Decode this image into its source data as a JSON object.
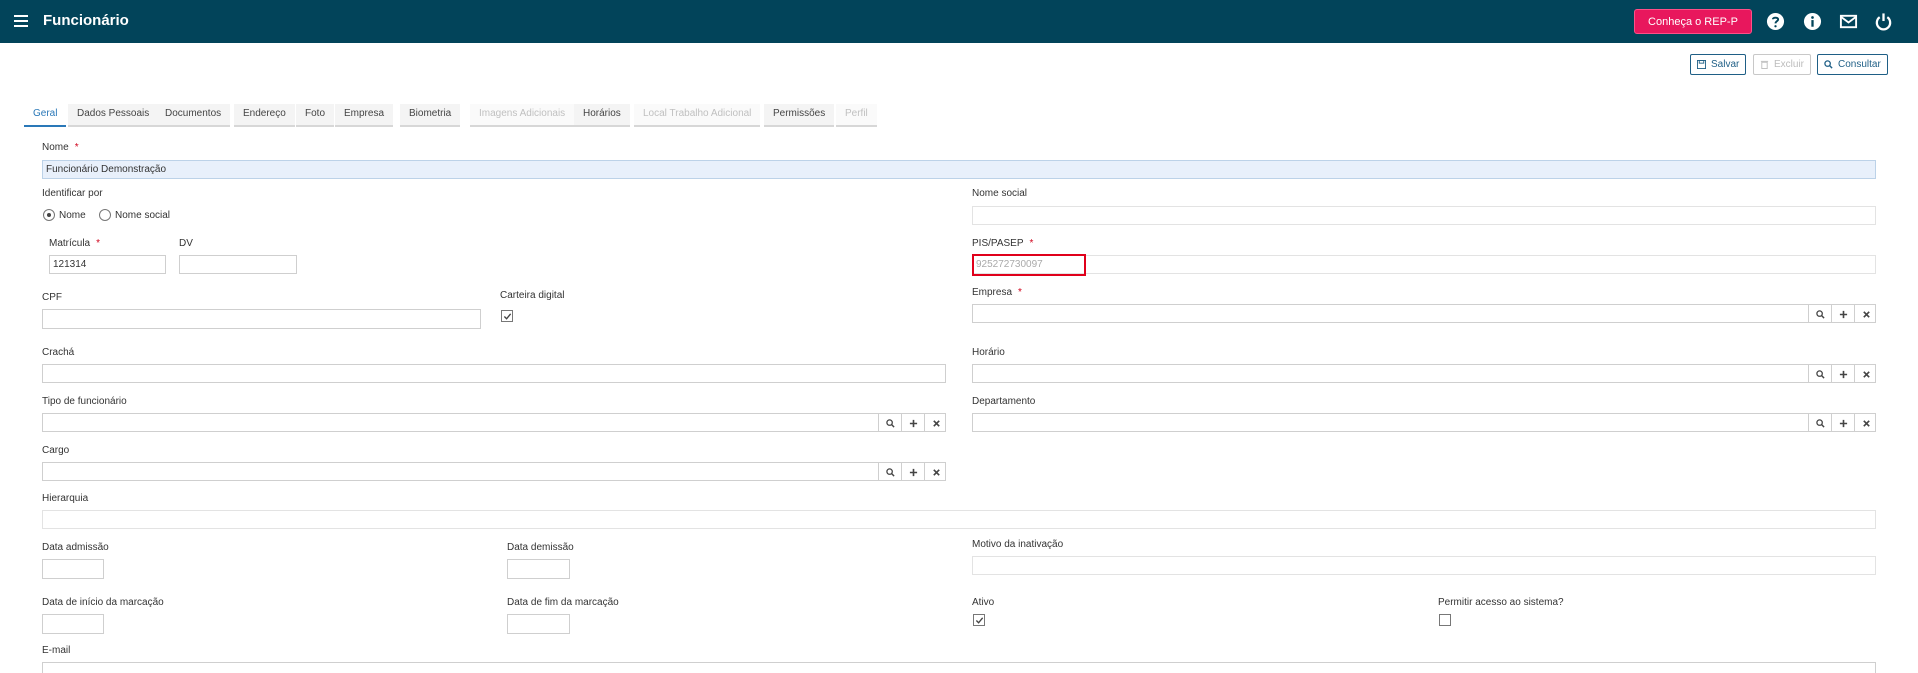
{
  "header": {
    "title": "Funcionário",
    "rep_button": "Conheça o REP-P",
    "icons": [
      "menu-icon",
      "help-icon",
      "info-icon",
      "mail-icon",
      "power-icon"
    ]
  },
  "toolbar": {
    "save_label": "Salvar",
    "delete_label": "Excluir",
    "search_label": "Consultar"
  },
  "tabs": [
    {
      "label": "Geral",
      "state": "active"
    },
    {
      "label": "Dados Pessoais",
      "state": "normal"
    },
    {
      "label": "Documentos",
      "state": "normal"
    },
    {
      "label": "Endereço",
      "state": "normal"
    },
    {
      "label": "Foto",
      "state": "normal"
    },
    {
      "label": "Empresa",
      "state": "normal"
    },
    {
      "label": "Biometria",
      "state": "normal"
    },
    {
      "label": "Imagens Adicionais",
      "state": "disabled"
    },
    {
      "label": "Horários",
      "state": "normal"
    },
    {
      "label": "Local Trabalho Adicional",
      "state": "disabled"
    },
    {
      "label": "Permissões",
      "state": "normal"
    },
    {
      "label": "Perfil",
      "state": "disabled"
    }
  ],
  "form": {
    "nome": {
      "label": "Nome",
      "required_mark": "*",
      "value": "Funcionário Demonstração"
    },
    "identificar_por": {
      "label": "Identificar por",
      "options": [
        "Nome",
        "Nome social"
      ],
      "selected": "Nome"
    },
    "nome_social": {
      "label": "Nome social",
      "value": ""
    },
    "matricula": {
      "label": "Matrícula",
      "required_mark": "*",
      "value": "121314"
    },
    "dv": {
      "label": "DV",
      "value": ""
    },
    "pis_pasep": {
      "label": "PIS/PASEP",
      "required_mark": "*",
      "placeholder": "925272730097"
    },
    "cpf": {
      "label": "CPF",
      "value": ""
    },
    "carteira_digital": {
      "label": "Carteira digital",
      "checked": true
    },
    "empresa": {
      "label": "Empresa",
      "required_mark": "*",
      "value": ""
    },
    "cracha": {
      "label": "Crachá",
      "value": ""
    },
    "horario": {
      "label": "Horário",
      "value": ""
    },
    "tipo_funcionario": {
      "label": "Tipo de funcionário",
      "value": ""
    },
    "departamento": {
      "label": "Departamento",
      "value": ""
    },
    "cargo": {
      "label": "Cargo",
      "value": ""
    },
    "hierarquia": {
      "label": "Hierarquia",
      "value": ""
    },
    "data_admissao": {
      "label": "Data admissão",
      "value": ""
    },
    "data_demissao": {
      "label": "Data demissão",
      "value": ""
    },
    "motivo_inativacao": {
      "label": "Motivo da inativação",
      "value": ""
    },
    "data_inicio_marcacao": {
      "label": "Data de início da marcação",
      "value": ""
    },
    "data_fim_marcacao": {
      "label": "Data de fim da marcação",
      "value": ""
    },
    "ativo": {
      "label": "Ativo",
      "checked": true
    },
    "permitir_acesso": {
      "label": "Permitir acesso ao sistema?",
      "checked": false
    },
    "email": {
      "label": "E-mail",
      "value": ""
    }
  },
  "colors": {
    "header_bg": "#02445a",
    "accent": "#2a78b8",
    "rep_button": "#e8175d",
    "required": "#d0021b",
    "highlight": "#e0001b"
  }
}
